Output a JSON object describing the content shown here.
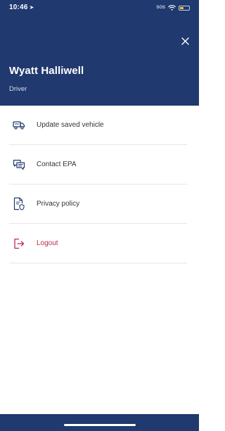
{
  "status_bar": {
    "time": "10:46",
    "location_icon": "location-arrow-icon",
    "sos": "SOS",
    "wifi_icon": "wifi-icon",
    "battery_icon": "battery-icon"
  },
  "header": {
    "close_icon": "close-icon",
    "user_name": "Wyatt Halliwell",
    "user_role": "Driver",
    "background_color": "#20396e"
  },
  "menu": {
    "items": [
      {
        "label": "Update saved vehicle",
        "icon": "truck-icon"
      },
      {
        "label": "Contact EPA",
        "icon": "chat-bubbles-icon"
      },
      {
        "label": "Privacy policy",
        "icon": "document-shield-icon"
      },
      {
        "label": "Logout",
        "icon": "logout-icon"
      }
    ],
    "icon_color": "#20396e",
    "logout_color": "#c1274b"
  }
}
